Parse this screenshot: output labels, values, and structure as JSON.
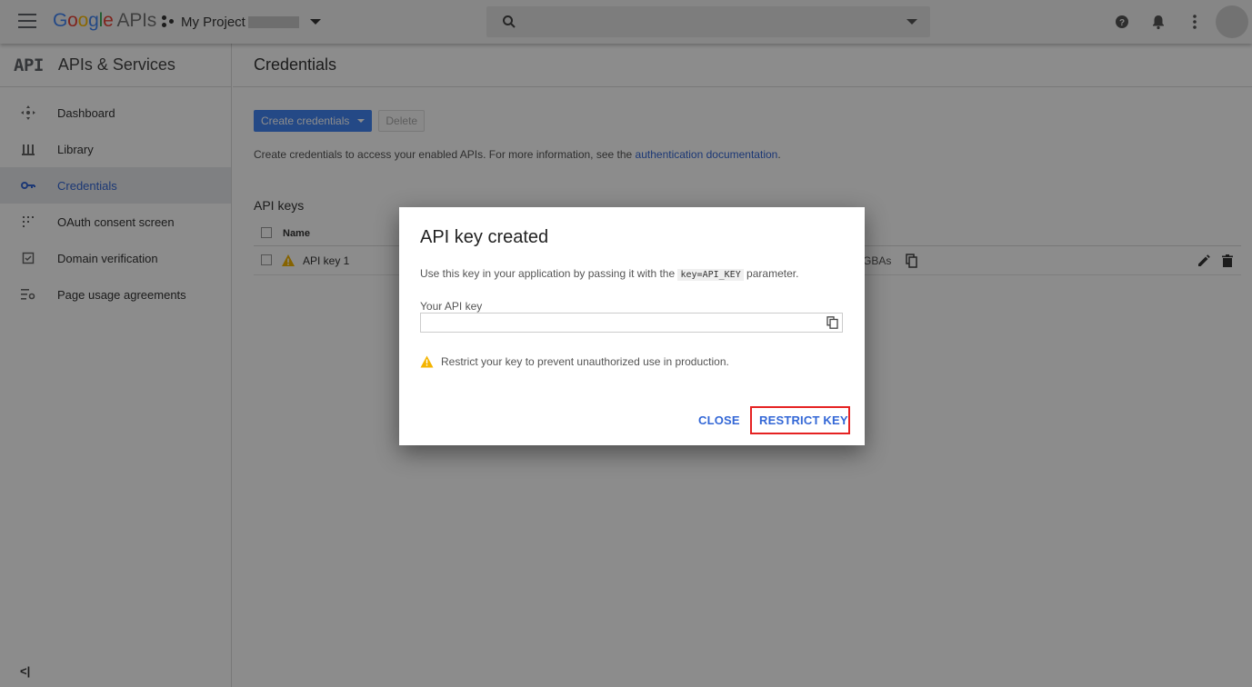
{
  "topbar": {
    "logo_google": [
      "G",
      "o",
      "o",
      "g",
      "l",
      "e"
    ],
    "logo_apis": "APIs",
    "project_name": "My Project",
    "search": {
      "placeholder": ""
    }
  },
  "sidebar": {
    "logo_text": "API",
    "title": "APIs & Services",
    "items": [
      {
        "label": "Dashboard",
        "icon": "dashboard-icon"
      },
      {
        "label": "Library",
        "icon": "library-icon"
      },
      {
        "label": "Credentials",
        "icon": "key-icon",
        "active": true
      },
      {
        "label": "OAuth consent screen",
        "icon": "oauth-icon"
      },
      {
        "label": "Domain verification",
        "icon": "domain-check-icon"
      },
      {
        "label": "Page usage agreements",
        "icon": "settings-list-icon"
      }
    ],
    "collapse_label": "<|"
  },
  "main": {
    "page_title": "Credentials",
    "toolbar": {
      "create_label": "Create credentials",
      "delete_label": "Delete"
    },
    "description": {
      "text": "Create credentials to access your enabled APIs. For more information, see the ",
      "link": "authentication documentation",
      "suffix": "."
    },
    "api_keys": {
      "section_title": "API keys",
      "columns": [
        "Name"
      ],
      "rows": [
        {
          "name": "API key 1",
          "key_tail": "GBAs"
        }
      ]
    }
  },
  "dialog": {
    "title": "API key created",
    "text_before": "Use this key in your application by passing it with the ",
    "code": "key=API_KEY",
    "text_after": " parameter.",
    "field_label": "Your API key",
    "field_value": "",
    "warning": "Restrict your key to prevent unauthorized use in production.",
    "close_label": "CLOSE",
    "restrict_label": "RESTRICT KEY"
  },
  "colors": {
    "accent": "#3367d6",
    "primary_button": "#4285f4",
    "highlight": "#e52222",
    "warning": "#f4b400"
  }
}
